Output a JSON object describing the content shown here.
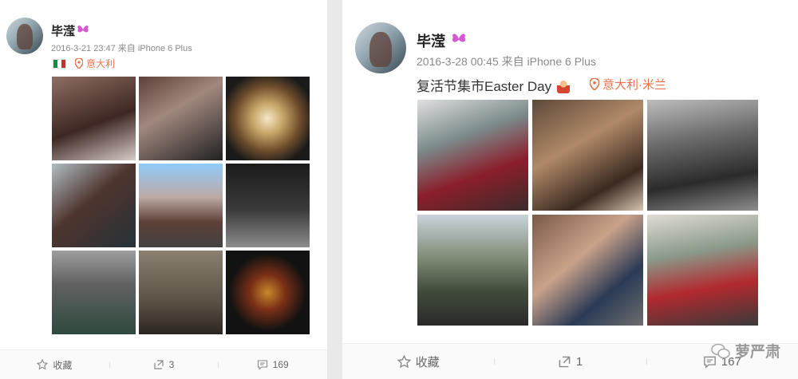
{
  "left_post": {
    "username": "毕滢",
    "meta": "2016-3-21 23:47 来自 iPhone 6 Plus",
    "location": "意大利",
    "actions": {
      "favorite": "收藏",
      "repost": "3",
      "comment": "169"
    },
    "photos": [
      "photo-1",
      "photo-2",
      "photo-3",
      "photo-4",
      "photo-5",
      "photo-6",
      "photo-7",
      "photo-8",
      "photo-9"
    ]
  },
  "right_post": {
    "username": "毕滢",
    "meta": "2016-3-28 00:45 来自 iPhone 6 Plus",
    "text": "复活节集市Easter Day",
    "location": "意大利·米兰",
    "actions": {
      "favorite": "收藏",
      "repost": "1",
      "comment": "167"
    },
    "photos": [
      "photo-1",
      "photo-2",
      "photo-3",
      "photo-4",
      "photo-5",
      "photo-6"
    ]
  },
  "watermark": "萝严肃",
  "colors": {
    "accent": "#eb7350",
    "vip_badge": "#d45ad3"
  }
}
